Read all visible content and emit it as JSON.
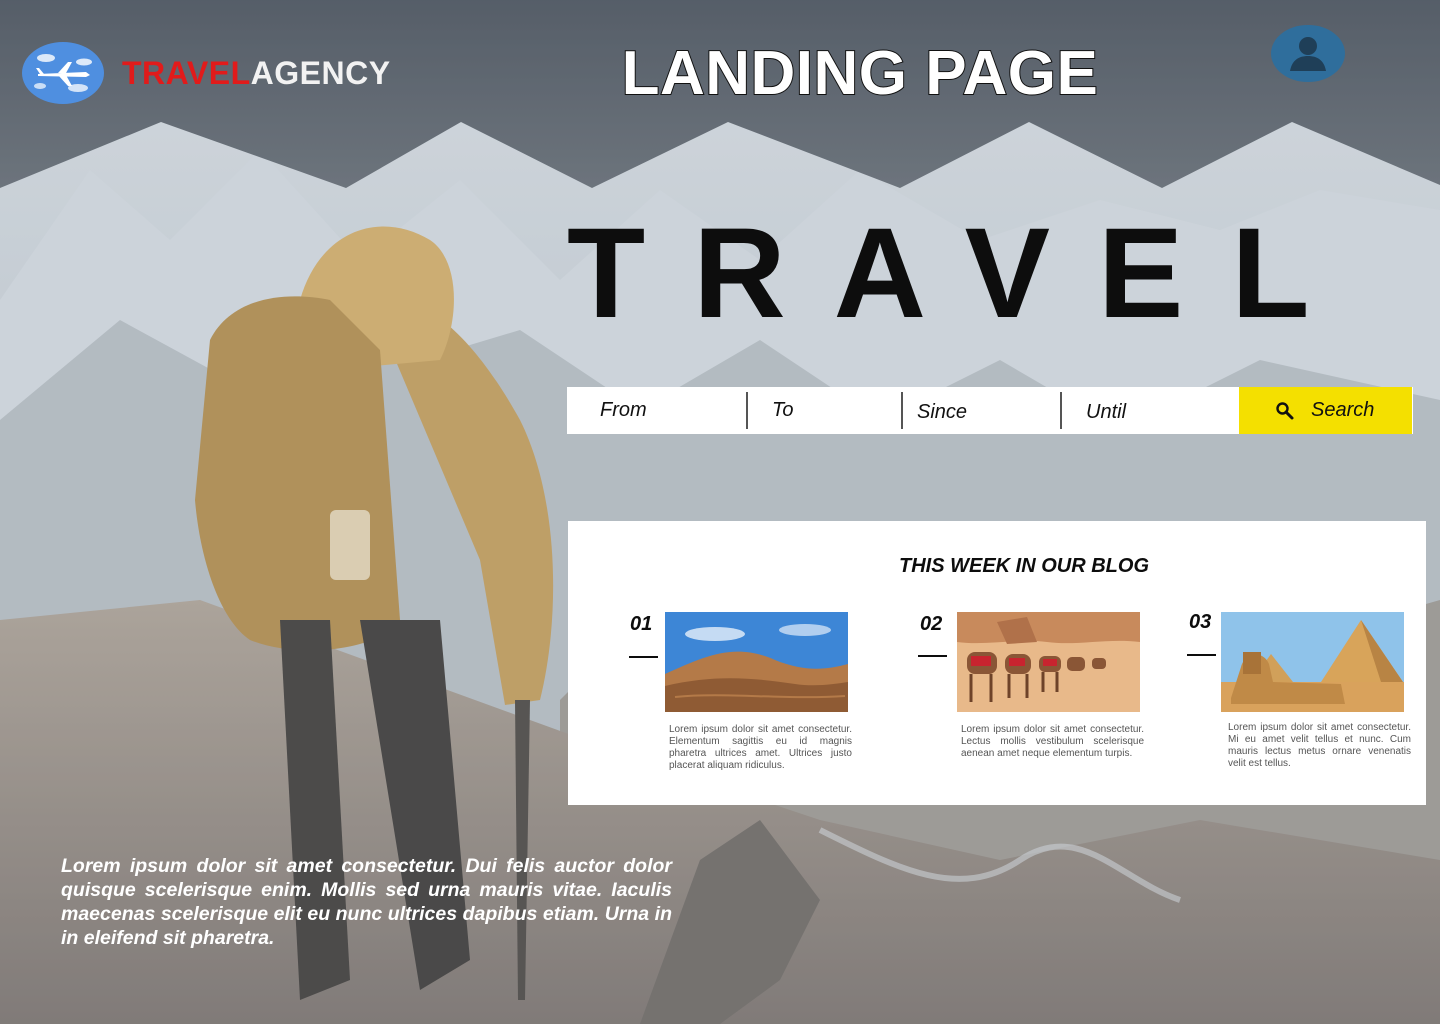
{
  "brand": {
    "part1": "TRAVEL",
    "part2": "AGENCY",
    "logo_icon": "airplane-globe-icon"
  },
  "header": {
    "title": "LANDING PAGE",
    "profile_icon": "user-profile-icon"
  },
  "hero": {
    "title": "TRAVEL"
  },
  "search": {
    "from_placeholder": "From",
    "to_placeholder": "To",
    "since_placeholder": "Since",
    "until_placeholder": "Until",
    "button_label": "Search",
    "button_icon": "search-icon",
    "button_color": "#f4e000"
  },
  "blog": {
    "title": "THIS WEEK IN OUR BLOG",
    "cards": [
      {
        "number": "01",
        "image": "desert-dunes-photo",
        "text": "Lorem ipsum dolor sit amet consectetur. Elementum sagittis eu id magnis pharetra ultrices amet. Ultrices justo placerat aliquam ridiculus."
      },
      {
        "number": "02",
        "image": "camel-caravan-photo",
        "text": "Lorem ipsum dolor sit amet consectetur. Lectus mollis vestibulum scelerisque aenean amet neque elementum turpis."
      },
      {
        "number": "03",
        "image": "sphinx-pyramids-photo",
        "text": "Lorem ipsum dolor sit amet consectetur. Mi eu amet velit tellus et nunc. Cum mauris lectus metus ornare venenatis velit est tellus."
      }
    ]
  },
  "intro": {
    "text": "Lorem ipsum dolor sit amet consectetur. Dui felis auctor dolor quisque scelerisque enim. Mollis sed urna mauris vitae. Iaculis maecenas scelerisque elit eu nunc ultrices dapibus etiam. Urna in in eleifend sit pharetra."
  },
  "colors": {
    "brand_red": "#e11b1b",
    "accent_yellow": "#f4e000",
    "profile_blue": "#2f6e9c"
  }
}
